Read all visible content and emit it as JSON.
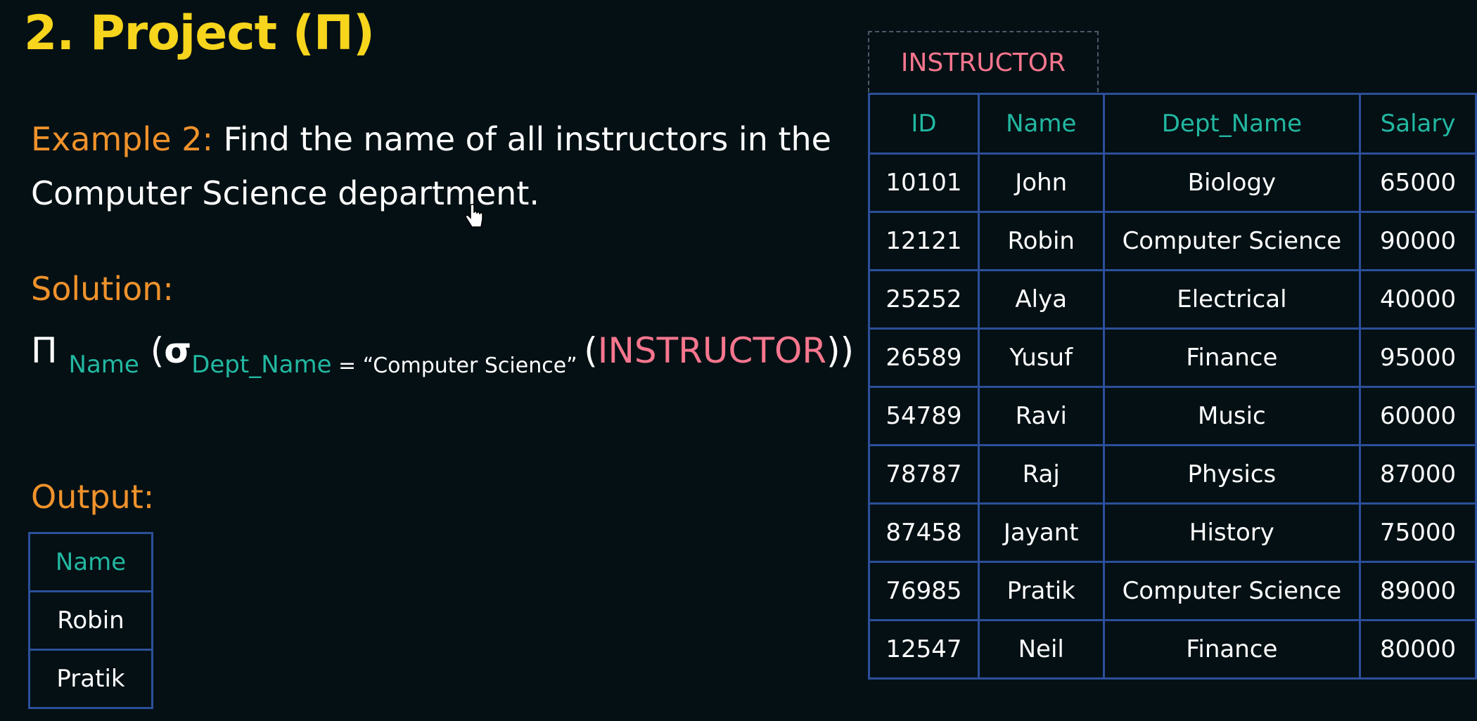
{
  "title": "2. Project (Π)",
  "question": {
    "label": "Example 2:",
    "text": " Find the name of all instructors in the Computer Science department."
  },
  "solution": {
    "label": "Solution:",
    "pi": "Π",
    "pi_sub": "Name",
    "open_paren": " (",
    "sigma": "σ",
    "sigma_sub": "Dept_Name",
    "condition": " = “Computer Science” ",
    "relation_open": "(",
    "relation": "INSTRUCTOR",
    "relation_close": "))"
  },
  "output": {
    "label": "Output:",
    "header": "Name",
    "rows": [
      "Robin",
      "Pratik"
    ]
  },
  "instructor": {
    "relation_name": "INSTRUCTOR",
    "columns": [
      "ID",
      "Name",
      "Dept_Name",
      "Salary"
    ],
    "rows": [
      [
        "10101",
        "John",
        "Biology",
        "65000"
      ],
      [
        "12121",
        "Robin",
        "Computer Science",
        "90000"
      ],
      [
        "25252",
        "Alya",
        "Electrical",
        "40000"
      ],
      [
        "26589",
        "Yusuf",
        "Finance",
        "95000"
      ],
      [
        "54789",
        "Ravi",
        "Music",
        "60000"
      ],
      [
        "78787",
        "Raj",
        "Physics",
        "87000"
      ],
      [
        "87458",
        "Jayant",
        "History",
        "75000"
      ],
      [
        "76985",
        "Pratik",
        "Computer Science",
        "89000"
      ],
      [
        "12547",
        "Neil",
        "Finance",
        "80000"
      ]
    ]
  },
  "colors": {
    "background": "#041014",
    "title": "#f6d51c",
    "label": "#f0922b",
    "attribute": "#22b8a1",
    "relation": "#f7768e",
    "border": "#2c4f9a"
  },
  "icons": {
    "cursor": "hand-pointer-icon"
  }
}
